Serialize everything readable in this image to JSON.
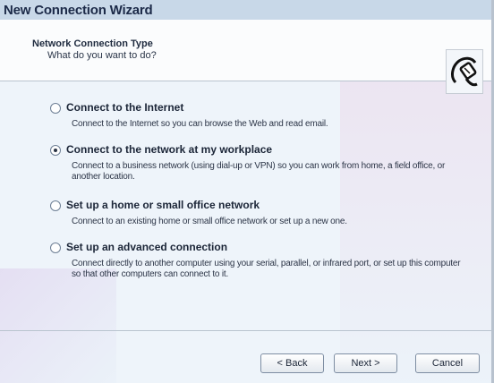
{
  "window": {
    "title": "New Connection Wizard"
  },
  "header": {
    "title": "Network Connection Type",
    "subtitle": "What do you want to do?",
    "icon": "network-connection-icon"
  },
  "options": [
    {
      "label": "Connect to the Internet",
      "description": "Connect to the Internet so you can browse the Web and read email.",
      "selected": false
    },
    {
      "label": "Connect to the network at my workplace",
      "description": "Connect to a business network (using dial-up or VPN) so you can work from home, a field office, or another location.",
      "selected": true
    },
    {
      "label": "Set up a home or small office network",
      "description": "Connect to an existing home or small office network or set up a new one.",
      "selected": false
    },
    {
      "label": "Set up an advanced connection",
      "description": "Connect directly to another computer using your serial, parallel, or infrared port, or set up this computer so that other computers can connect to it.",
      "selected": false
    }
  ],
  "buttons": {
    "back": "< Back",
    "next": "Next >",
    "cancel": "Cancel"
  }
}
